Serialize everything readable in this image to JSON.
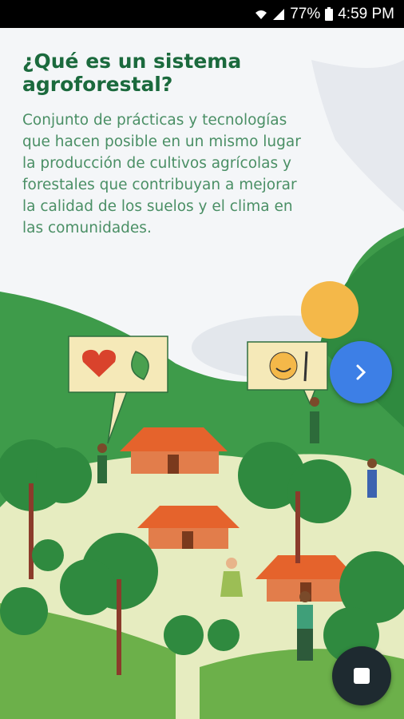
{
  "status_bar": {
    "battery_percent": "77%",
    "time": "4:59 PM",
    "icons": [
      "wifi-icon",
      "signal-icon",
      "battery-icon"
    ]
  },
  "intro": {
    "title": "¿Qué es un sistema agroforestal?",
    "description": "Conjunto de prácticas y tecnologías que hacen posible en un mismo lugar la producción de cultivos agrícolas y forestales que contribuyan a mejorar la calidad de los suelos y el clima en las comunidades."
  },
  "buttons": {
    "next_icon": "chevron-right-icon",
    "stop_icon": "stop-icon"
  },
  "colors": {
    "title": "#1b6a3d",
    "text": "#4a8f65",
    "next_button": "#3d7fe6",
    "stop_button": "#1e2a30",
    "forest_green": "#3e9b4a",
    "roof": "#e5632c"
  }
}
